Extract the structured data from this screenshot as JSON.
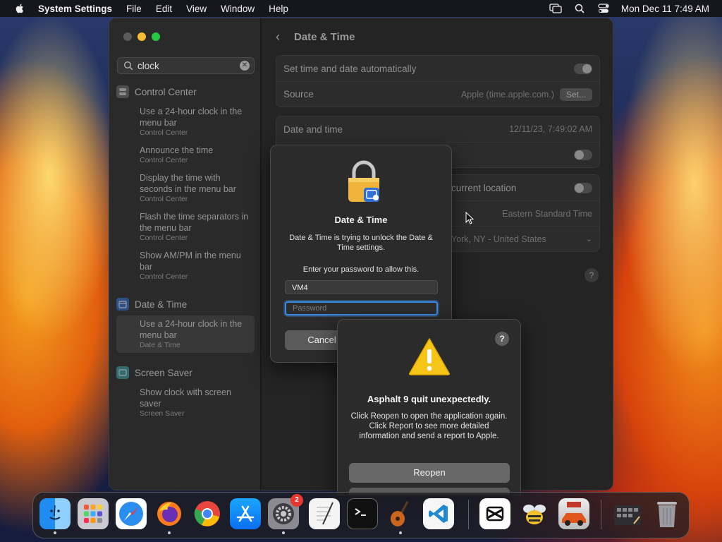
{
  "menubar": {
    "app_name": "System Settings",
    "menus": [
      "File",
      "Edit",
      "View",
      "Window",
      "Help"
    ],
    "clock": "Mon Dec 11  7:49 AM"
  },
  "sidebar": {
    "search_value": "clock",
    "groups": [
      {
        "category": "Control Center",
        "results": [
          {
            "title": "Use a 24-hour clock in the menu bar",
            "subtitle": "Control Center"
          },
          {
            "title": "Announce the time",
            "subtitle": "Control Center"
          },
          {
            "title": "Display the time with seconds in the menu bar",
            "subtitle": "Control Center"
          },
          {
            "title": "Flash the time separators in the menu bar",
            "subtitle": "Control Center"
          },
          {
            "title": "Show AM/PM in the menu bar",
            "subtitle": "Control Center"
          }
        ]
      },
      {
        "category": "Date & Time",
        "results": [
          {
            "title": "Use a 24-hour clock in the menu bar",
            "subtitle": "Date & Time"
          }
        ]
      },
      {
        "category": "Screen Saver",
        "results": [
          {
            "title": "Show clock with screen saver",
            "subtitle": "Screen Saver"
          }
        ]
      }
    ]
  },
  "content": {
    "title": "Date & Time",
    "set_auto_label": "Set time and date automatically",
    "source_label": "Source",
    "source_value": "Apple (time.apple.com.)",
    "set_button": "Set...",
    "date_time_label": "Date and time",
    "date_time_value": "12/11/23, 7:49:02 AM",
    "location_label": "current location",
    "timezone_value": "Eastern Standard Time",
    "city_value": "York, NY - United States"
  },
  "auth_dialog": {
    "title": "Date & Time",
    "message": "Date & Time is trying to unlock the Date & Time settings.",
    "prompt": "Enter your password to allow this.",
    "username": "VM4",
    "password_placeholder": "Password",
    "cancel": "Cancel"
  },
  "crash_dialog": {
    "help": "?",
    "title": "Asphalt 9 quit unexpectedly.",
    "message": "Click Reopen to open the application again. Click Report to see more detailed information and send a report to Apple.",
    "reopen": "Reopen"
  },
  "dock": {
    "settings_badge": "2",
    "apps": [
      "Finder",
      "Launchpad",
      "Safari",
      "Firefox",
      "Chrome",
      "App Store",
      "System Settings",
      "TextEdit",
      "Terminal",
      "GarageBand",
      "Visual Studio Code",
      "CapCut",
      "Cider",
      "Asphalt 9",
      "Downloads",
      "Trash"
    ]
  },
  "colors": {
    "accent": "#3d8be6",
    "window_bg": "#1e1e1e",
    "sidebar_bg": "#2a2a2a",
    "warning_yellow": "#f5c518"
  }
}
